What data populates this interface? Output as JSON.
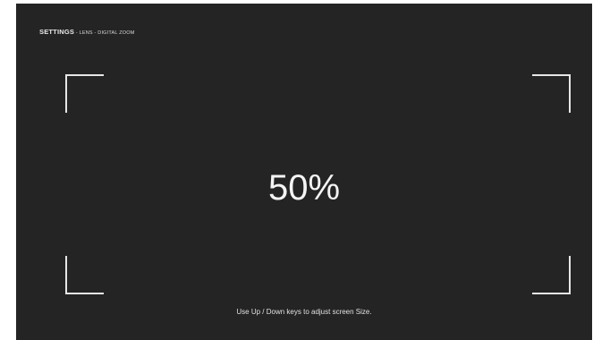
{
  "breadcrumb": {
    "root": "SETTINGS",
    "separator": " - ",
    "level1": "LENS",
    "level2": "DIGITAL ZOOM"
  },
  "zoom": {
    "value": "50%"
  },
  "hint": "Use Up / Down keys to adjust screen Size.",
  "colors": {
    "background": "#242424",
    "text": "#f2f2f2",
    "frame": "#e6e6e6"
  }
}
